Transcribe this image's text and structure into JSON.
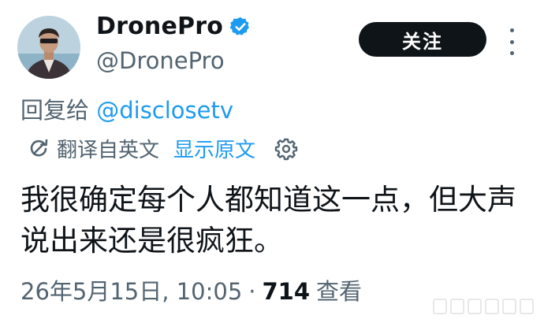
{
  "author": {
    "display_name": "DronePro",
    "handle": "@DronePro",
    "verified": true
  },
  "follow_button": {
    "label": "关注"
  },
  "reply": {
    "prefix": "回复给",
    "mention": "@disclosetv"
  },
  "translation": {
    "label": "翻译自英文",
    "show_original": "显示原文"
  },
  "tweet_text": "我很确定每个人都知道这一点，但大声说出来还是很疯狂。",
  "meta": {
    "timestamp": "26年5月15日, 10:05",
    "separator": "·",
    "views_count": "714",
    "views_label": "查看"
  },
  "colors": {
    "accent": "#1d9bf0",
    "text_primary": "#0f1419",
    "text_secondary": "#536471",
    "button_bg": "#0f1419"
  },
  "icons": [
    "verified-badge-icon",
    "more-options-icon",
    "translate-icon",
    "gear-icon"
  ]
}
